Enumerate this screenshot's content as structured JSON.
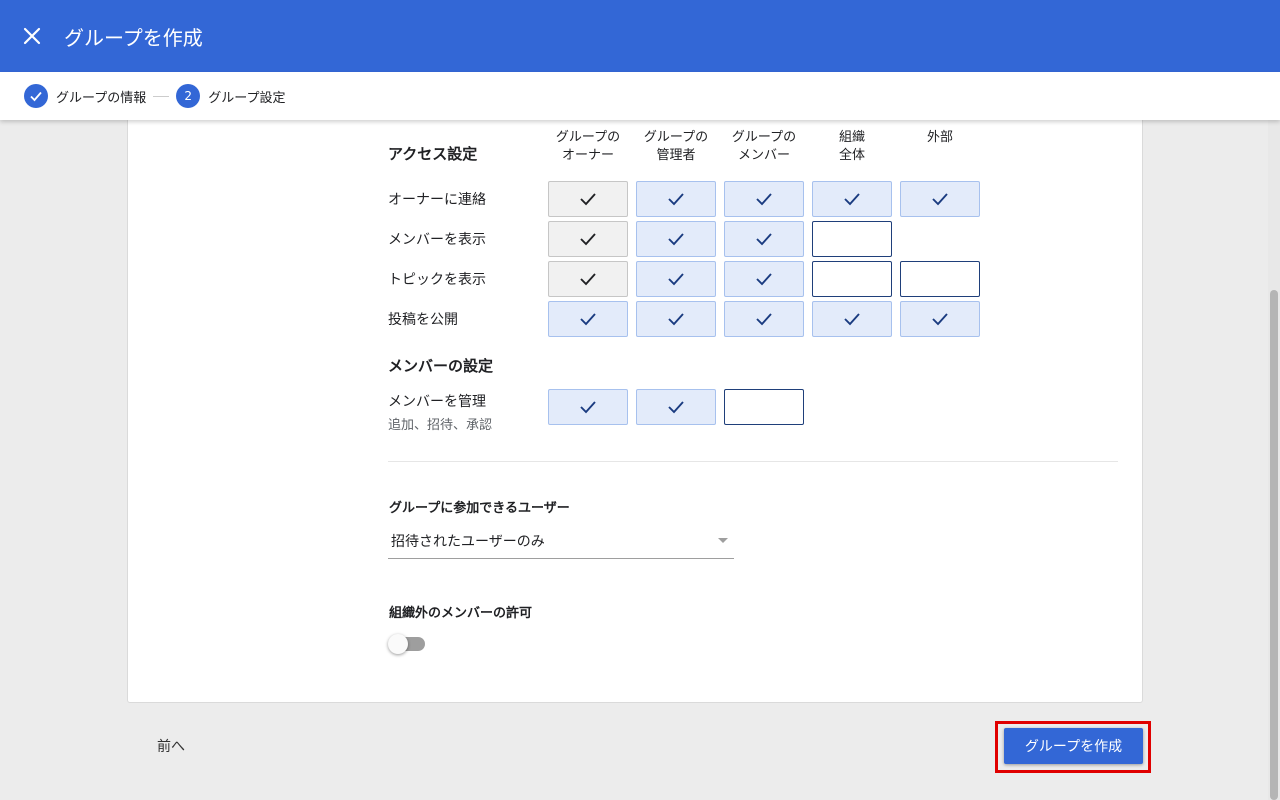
{
  "header": {
    "title": "グループを作成",
    "close_icon": "close-icon"
  },
  "stepper": {
    "steps": [
      {
        "label": "グループの情報",
        "state": "done"
      },
      {
        "label": "グループ設定",
        "number": "2",
        "state": "active"
      }
    ]
  },
  "access": {
    "title": "アクセス設定",
    "columns": [
      {
        "line1": "グループの",
        "line2": "オーナー"
      },
      {
        "line1": "グループの",
        "line2": "管理者"
      },
      {
        "line1": "グループの",
        "line2": "メンバー"
      },
      {
        "line1": "組織",
        "line2": "全体"
      },
      {
        "line1": "外部",
        "line2": ""
      }
    ],
    "rows": [
      {
        "label": "オーナーに連絡",
        "cells": [
          "owner",
          "on",
          "on",
          "on",
          "on"
        ]
      },
      {
        "label": "メンバーを表示",
        "cells": [
          "owner",
          "on",
          "on",
          "off",
          "blank"
        ]
      },
      {
        "label": "トピックを表示",
        "cells": [
          "owner",
          "on",
          "on",
          "off",
          "off"
        ]
      },
      {
        "label": "投稿を公開",
        "cells": [
          "on",
          "on",
          "on",
          "on",
          "on"
        ]
      }
    ]
  },
  "members": {
    "title": "メンバーの設定",
    "rows": [
      {
        "label": "メンバーを管理",
        "sublabel": "追加、招待、承認",
        "cells": [
          "on",
          "on",
          "off"
        ]
      }
    ]
  },
  "join": {
    "label": "グループに参加できるユーザー",
    "value": "招待されたユーザーのみ"
  },
  "external": {
    "label": "組織外のメンバーの許可",
    "enabled": false
  },
  "footer": {
    "prev_label": "前へ",
    "create_label": "グループを作成"
  },
  "colors": {
    "primary": "#3367d6",
    "check": "#1a3b80",
    "highlight": "#e00000"
  }
}
